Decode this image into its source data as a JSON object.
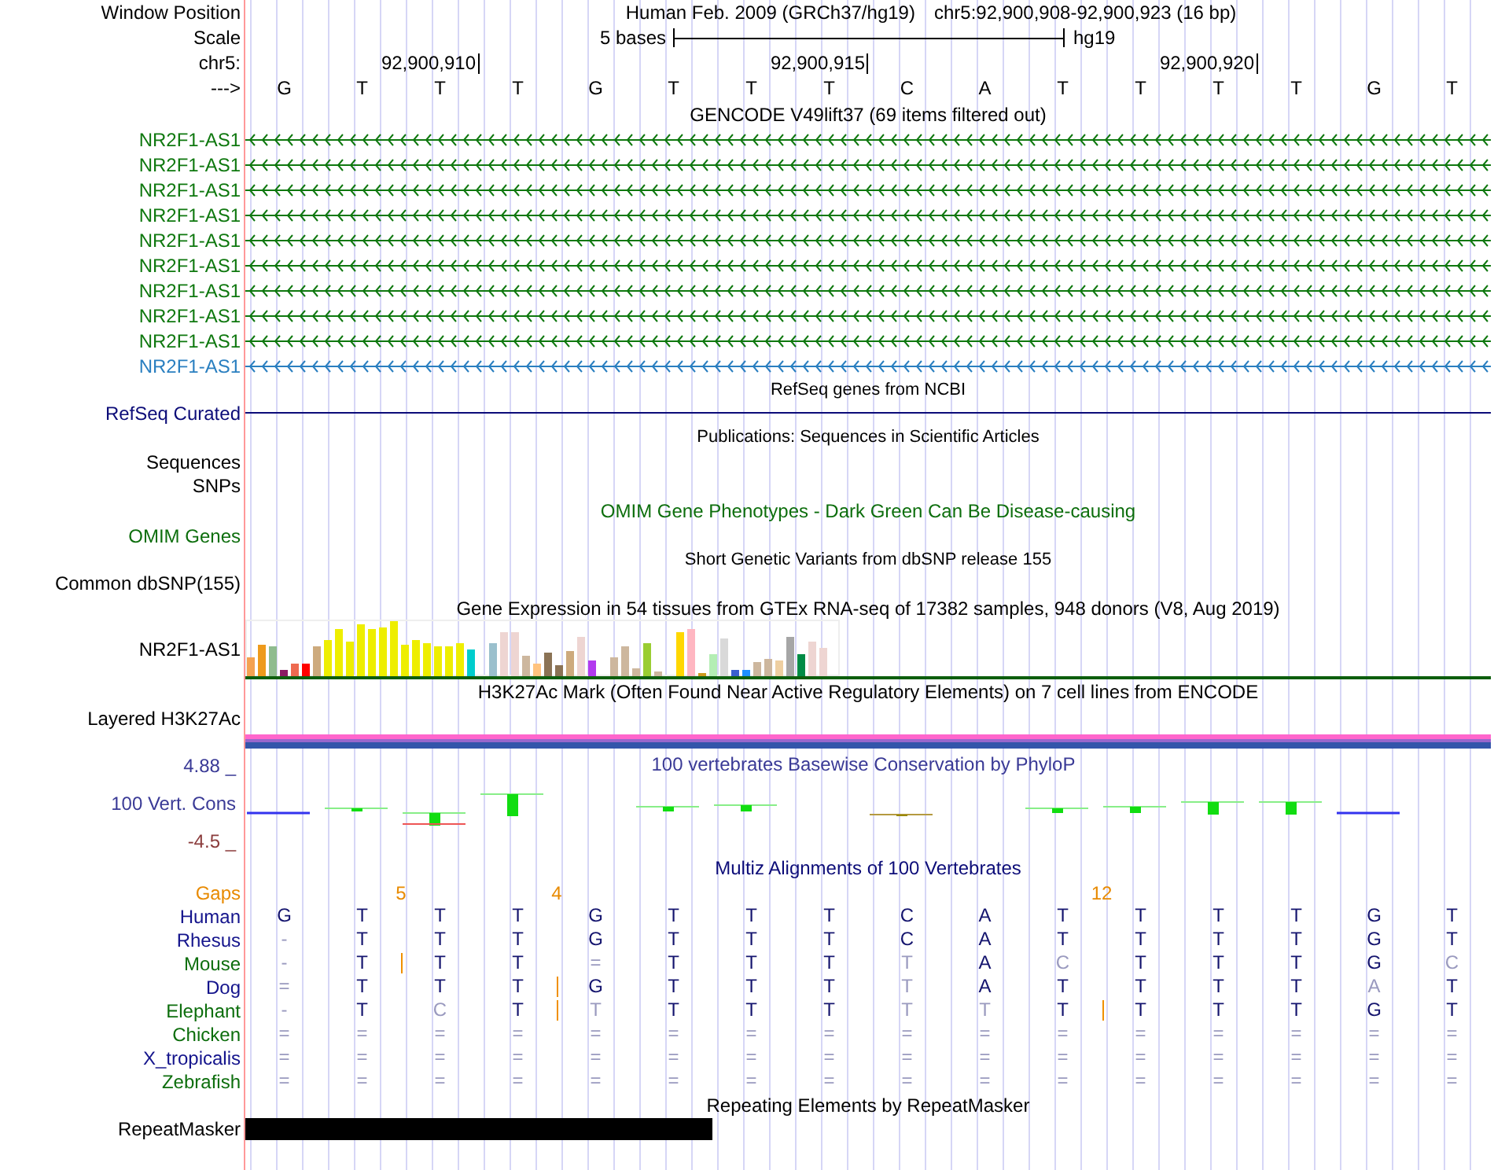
{
  "header": {
    "label": "Window Position",
    "assembly": "Human Feb. 2009 (GRCh37/hg19)",
    "position": "chr5:92,900,908-92,900,923 (16 bp)"
  },
  "scale": {
    "label": "Scale",
    "span": "5 bases",
    "db": "hg19"
  },
  "ruler": {
    "label": "chr5:",
    "strand_label": "--->"
  },
  "columns": [
    {
      "base": "G"
    },
    {
      "base": "T",
      "gap": "5"
    },
    {
      "base": "T",
      "tick": "92,900,910"
    },
    {
      "base": "T",
      "gap": "4"
    },
    {
      "base": "G"
    },
    {
      "base": "T"
    },
    {
      "base": "T"
    },
    {
      "base": "T",
      "tick": "92,900,915"
    },
    {
      "base": "C"
    },
    {
      "base": "A"
    },
    {
      "base": "T",
      "gap": "12"
    },
    {
      "base": "T"
    },
    {
      "base": "T",
      "tick": "92,900,920"
    },
    {
      "base": "T"
    },
    {
      "base": "G"
    },
    {
      "base": "T"
    }
  ],
  "gencode": {
    "title": "GENCODE V49lift37 (69 items filtered out)",
    "items": [
      {
        "name": "NR2F1-AS1",
        "color": "#0f780f"
      },
      {
        "name": "NR2F1-AS1",
        "color": "#0f780f"
      },
      {
        "name": "NR2F1-AS1",
        "color": "#0f780f"
      },
      {
        "name": "NR2F1-AS1",
        "color": "#0f780f"
      },
      {
        "name": "NR2F1-AS1",
        "color": "#0f780f"
      },
      {
        "name": "NR2F1-AS1",
        "color": "#0f780f"
      },
      {
        "name": "NR2F1-AS1",
        "color": "#0f780f"
      },
      {
        "name": "NR2F1-AS1",
        "color": "#0f780f"
      },
      {
        "name": "NR2F1-AS1",
        "color": "#0f780f"
      },
      {
        "name": "NR2F1-AS1",
        "color": "#2a7fc0"
      }
    ]
  },
  "refseq": {
    "title": "RefSeq genes from NCBI",
    "label": "RefSeq Curated"
  },
  "publications": {
    "title": "Publications: Sequences in Scientific Articles",
    "labels": [
      "Sequences",
      "SNPs"
    ]
  },
  "omim": {
    "title": "OMIM Gene Phenotypes - Dark Green Can Be Disease-causing",
    "label": "OMIM Genes"
  },
  "dbsnp": {
    "title": "Short Genetic Variants from dbSNP release 155",
    "label": "Common dbSNP(155)"
  },
  "gtex": {
    "title": "Gene Expression in 54 tissues from GTEx RNA-seq of 17382 samples, 948 donors (V8, Aug 2019)",
    "label": "NR2F1-AS1"
  },
  "h3k27ac": {
    "title": "H3K27Ac Mark (Often Found Near Active Regulatory Elements) on 7 cell lines from ENCODE",
    "label": "Layered H3K27Ac"
  },
  "phylop": {
    "title": "100 vertebrates Basewise Conservation by PhyloP",
    "label": "100 Vert. Cons",
    "max": "4.88 _",
    "min": "-4.5 _"
  },
  "multiz": {
    "title": "Multiz Alignments of 100 Vertebrates",
    "gaps_label": "Gaps",
    "species": [
      {
        "name": "Human",
        "color": "#14148c",
        "cells": [
          {
            "b": "G",
            "faint": false,
            "insertion": false
          },
          {
            "b": "T",
            "faint": false,
            "insertion": false
          },
          {
            "b": "T",
            "faint": false,
            "insertion": false
          },
          {
            "b": "T",
            "faint": false,
            "insertion": false
          },
          {
            "b": "G",
            "faint": false,
            "insertion": false
          },
          {
            "b": "T",
            "faint": false,
            "insertion": false
          },
          {
            "b": "T",
            "faint": false,
            "insertion": false
          },
          {
            "b": "T",
            "faint": false,
            "insertion": false
          },
          {
            "b": "C",
            "faint": false,
            "insertion": false
          },
          {
            "b": "A",
            "faint": false,
            "insertion": false
          },
          {
            "b": "T",
            "faint": false,
            "insertion": false
          },
          {
            "b": "T",
            "faint": false,
            "insertion": false
          },
          {
            "b": "T",
            "faint": false,
            "insertion": false
          },
          {
            "b": "T",
            "faint": false,
            "insertion": false
          },
          {
            "b": "G",
            "faint": false,
            "insertion": false
          },
          {
            "b": "T",
            "faint": false,
            "insertion": false
          }
        ]
      },
      {
        "name": "Rhesus",
        "color": "#14148c",
        "cells": [
          {
            "b": "-",
            "faint": true,
            "insertion": false
          },
          {
            "b": "T",
            "faint": false,
            "insertion": false
          },
          {
            "b": "T",
            "faint": false,
            "insertion": false
          },
          {
            "b": "T",
            "faint": false,
            "insertion": false
          },
          {
            "b": "G",
            "faint": false,
            "insertion": false
          },
          {
            "b": "T",
            "faint": false,
            "insertion": false
          },
          {
            "b": "T",
            "faint": false,
            "insertion": false
          },
          {
            "b": "T",
            "faint": false,
            "insertion": false
          },
          {
            "b": "C",
            "faint": false,
            "insertion": false
          },
          {
            "b": "A",
            "faint": false,
            "insertion": false
          },
          {
            "b": "T",
            "faint": false,
            "insertion": false
          },
          {
            "b": "T",
            "faint": false,
            "insertion": false
          },
          {
            "b": "T",
            "faint": false,
            "insertion": false
          },
          {
            "b": "T",
            "faint": false,
            "insertion": false
          },
          {
            "b": "G",
            "faint": false,
            "insertion": false
          },
          {
            "b": "T",
            "faint": false,
            "insertion": false
          }
        ]
      },
      {
        "name": "Mouse",
        "color": "#0d6e0d",
        "cells": [
          {
            "b": "-",
            "faint": true,
            "insertion": false
          },
          {
            "b": "T",
            "faint": false,
            "insertion": true
          },
          {
            "b": "T",
            "faint": false,
            "insertion": false
          },
          {
            "b": "T",
            "faint": false,
            "insertion": false
          },
          {
            "b": "=",
            "faint": true,
            "insertion": false
          },
          {
            "b": "T",
            "faint": false,
            "insertion": false
          },
          {
            "b": "T",
            "faint": false,
            "insertion": false
          },
          {
            "b": "T",
            "faint": false,
            "insertion": false
          },
          {
            "b": "T",
            "faint": true,
            "insertion": false
          },
          {
            "b": "A",
            "faint": false,
            "insertion": false
          },
          {
            "b": "C",
            "faint": true,
            "insertion": false
          },
          {
            "b": "T",
            "faint": false,
            "insertion": false
          },
          {
            "b": "T",
            "faint": false,
            "insertion": false
          },
          {
            "b": "T",
            "faint": false,
            "insertion": false
          },
          {
            "b": "G",
            "faint": false,
            "insertion": false
          },
          {
            "b": "C",
            "faint": true,
            "insertion": false
          }
        ]
      },
      {
        "name": "Dog",
        "color": "#14148c",
        "cells": [
          {
            "b": "=",
            "faint": true,
            "insertion": false
          },
          {
            "b": "T",
            "faint": false,
            "insertion": false
          },
          {
            "b": "T",
            "faint": false,
            "insertion": false
          },
          {
            "b": "T",
            "faint": false,
            "insertion": true
          },
          {
            "b": "G",
            "faint": false,
            "insertion": false
          },
          {
            "b": "T",
            "faint": false,
            "insertion": false
          },
          {
            "b": "T",
            "faint": false,
            "insertion": false
          },
          {
            "b": "T",
            "faint": false,
            "insertion": false
          },
          {
            "b": "T",
            "faint": true,
            "insertion": false
          },
          {
            "b": "A",
            "faint": false,
            "insertion": false
          },
          {
            "b": "T",
            "faint": false,
            "insertion": false
          },
          {
            "b": "T",
            "faint": false,
            "insertion": false
          },
          {
            "b": "T",
            "faint": false,
            "insertion": false
          },
          {
            "b": "T",
            "faint": false,
            "insertion": false
          },
          {
            "b": "A",
            "faint": true,
            "insertion": false
          },
          {
            "b": "T",
            "faint": false,
            "insertion": false
          }
        ]
      },
      {
        "name": "Elephant",
        "color": "#0d6e0d",
        "cells": [
          {
            "b": "-",
            "faint": true,
            "insertion": false
          },
          {
            "b": "T",
            "faint": false,
            "insertion": false
          },
          {
            "b": "C",
            "faint": true,
            "insertion": false
          },
          {
            "b": "T",
            "faint": false,
            "insertion": true
          },
          {
            "b": "T",
            "faint": true,
            "insertion": false
          },
          {
            "b": "T",
            "faint": false,
            "insertion": false
          },
          {
            "b": "T",
            "faint": false,
            "insertion": false
          },
          {
            "b": "T",
            "faint": false,
            "insertion": false
          },
          {
            "b": "T",
            "faint": true,
            "insertion": false
          },
          {
            "b": "T",
            "faint": true,
            "insertion": false
          },
          {
            "b": "T",
            "faint": false,
            "insertion": true
          },
          {
            "b": "T",
            "faint": false,
            "insertion": false
          },
          {
            "b": "T",
            "faint": false,
            "insertion": false
          },
          {
            "b": "T",
            "faint": false,
            "insertion": false
          },
          {
            "b": "G",
            "faint": false,
            "insertion": false
          },
          {
            "b": "T",
            "faint": false,
            "insertion": false
          }
        ]
      },
      {
        "name": "Chicken",
        "color": "#0d6e0d",
        "cells": [
          {
            "b": "=",
            "faint": true,
            "insertion": false
          },
          {
            "b": "=",
            "faint": true,
            "insertion": false
          },
          {
            "b": "=",
            "faint": true,
            "insertion": false
          },
          {
            "b": "=",
            "faint": true,
            "insertion": false
          },
          {
            "b": "=",
            "faint": true,
            "insertion": false
          },
          {
            "b": "=",
            "faint": true,
            "insertion": false
          },
          {
            "b": "=",
            "faint": true,
            "insertion": false
          },
          {
            "b": "=",
            "faint": true,
            "insertion": false
          },
          {
            "b": "=",
            "faint": true,
            "insertion": false
          },
          {
            "b": "=",
            "faint": true,
            "insertion": false
          },
          {
            "b": "=",
            "faint": true,
            "insertion": false
          },
          {
            "b": "=",
            "faint": true,
            "insertion": false
          },
          {
            "b": "=",
            "faint": true,
            "insertion": false
          },
          {
            "b": "=",
            "faint": true,
            "insertion": false
          },
          {
            "b": "=",
            "faint": true,
            "insertion": false
          },
          {
            "b": "=",
            "faint": true,
            "insertion": false
          }
        ]
      },
      {
        "name": "X_tropicalis",
        "color": "#14148c",
        "cells": [
          {
            "b": "=",
            "faint": true,
            "insertion": false
          },
          {
            "b": "=",
            "faint": true,
            "insertion": false
          },
          {
            "b": "=",
            "faint": true,
            "insertion": false
          },
          {
            "b": "=",
            "faint": true,
            "insertion": false
          },
          {
            "b": "=",
            "faint": true,
            "insertion": false
          },
          {
            "b": "=",
            "faint": true,
            "insertion": false
          },
          {
            "b": "=",
            "faint": true,
            "insertion": false
          },
          {
            "b": "=",
            "faint": true,
            "insertion": false
          },
          {
            "b": "=",
            "faint": true,
            "insertion": false
          },
          {
            "b": "=",
            "faint": true,
            "insertion": false
          },
          {
            "b": "=",
            "faint": true,
            "insertion": false
          },
          {
            "b": "=",
            "faint": true,
            "insertion": false
          },
          {
            "b": "=",
            "faint": true,
            "insertion": false
          },
          {
            "b": "=",
            "faint": true,
            "insertion": false
          },
          {
            "b": "=",
            "faint": true,
            "insertion": false
          },
          {
            "b": "=",
            "faint": true,
            "insertion": false
          }
        ]
      },
      {
        "name": "Zebrafish",
        "color": "#0d6e0d",
        "cells": [
          {
            "b": "=",
            "faint": true,
            "insertion": false
          },
          {
            "b": "=",
            "faint": true,
            "insertion": false
          },
          {
            "b": "=",
            "faint": true,
            "insertion": false
          },
          {
            "b": "=",
            "faint": true,
            "insertion": false
          },
          {
            "b": "=",
            "faint": true,
            "insertion": false
          },
          {
            "b": "=",
            "faint": true,
            "insertion": false
          },
          {
            "b": "=",
            "faint": true,
            "insertion": false
          },
          {
            "b": "=",
            "faint": true,
            "insertion": false
          },
          {
            "b": "=",
            "faint": true,
            "insertion": false
          },
          {
            "b": "=",
            "faint": true,
            "insertion": false
          },
          {
            "b": "=",
            "faint": true,
            "insertion": false
          },
          {
            "b": "=",
            "faint": true,
            "insertion": false
          },
          {
            "b": "=",
            "faint": true,
            "insertion": false
          },
          {
            "b": "=",
            "faint": true,
            "insertion": false
          },
          {
            "b": "=",
            "faint": true,
            "insertion": false
          },
          {
            "b": "=",
            "faint": true,
            "insertion": false
          }
        ]
      }
    ]
  },
  "repeatmasker": {
    "title": "Repeating Elements by RepeatMasker",
    "label": "RepeatMasker"
  }
}
